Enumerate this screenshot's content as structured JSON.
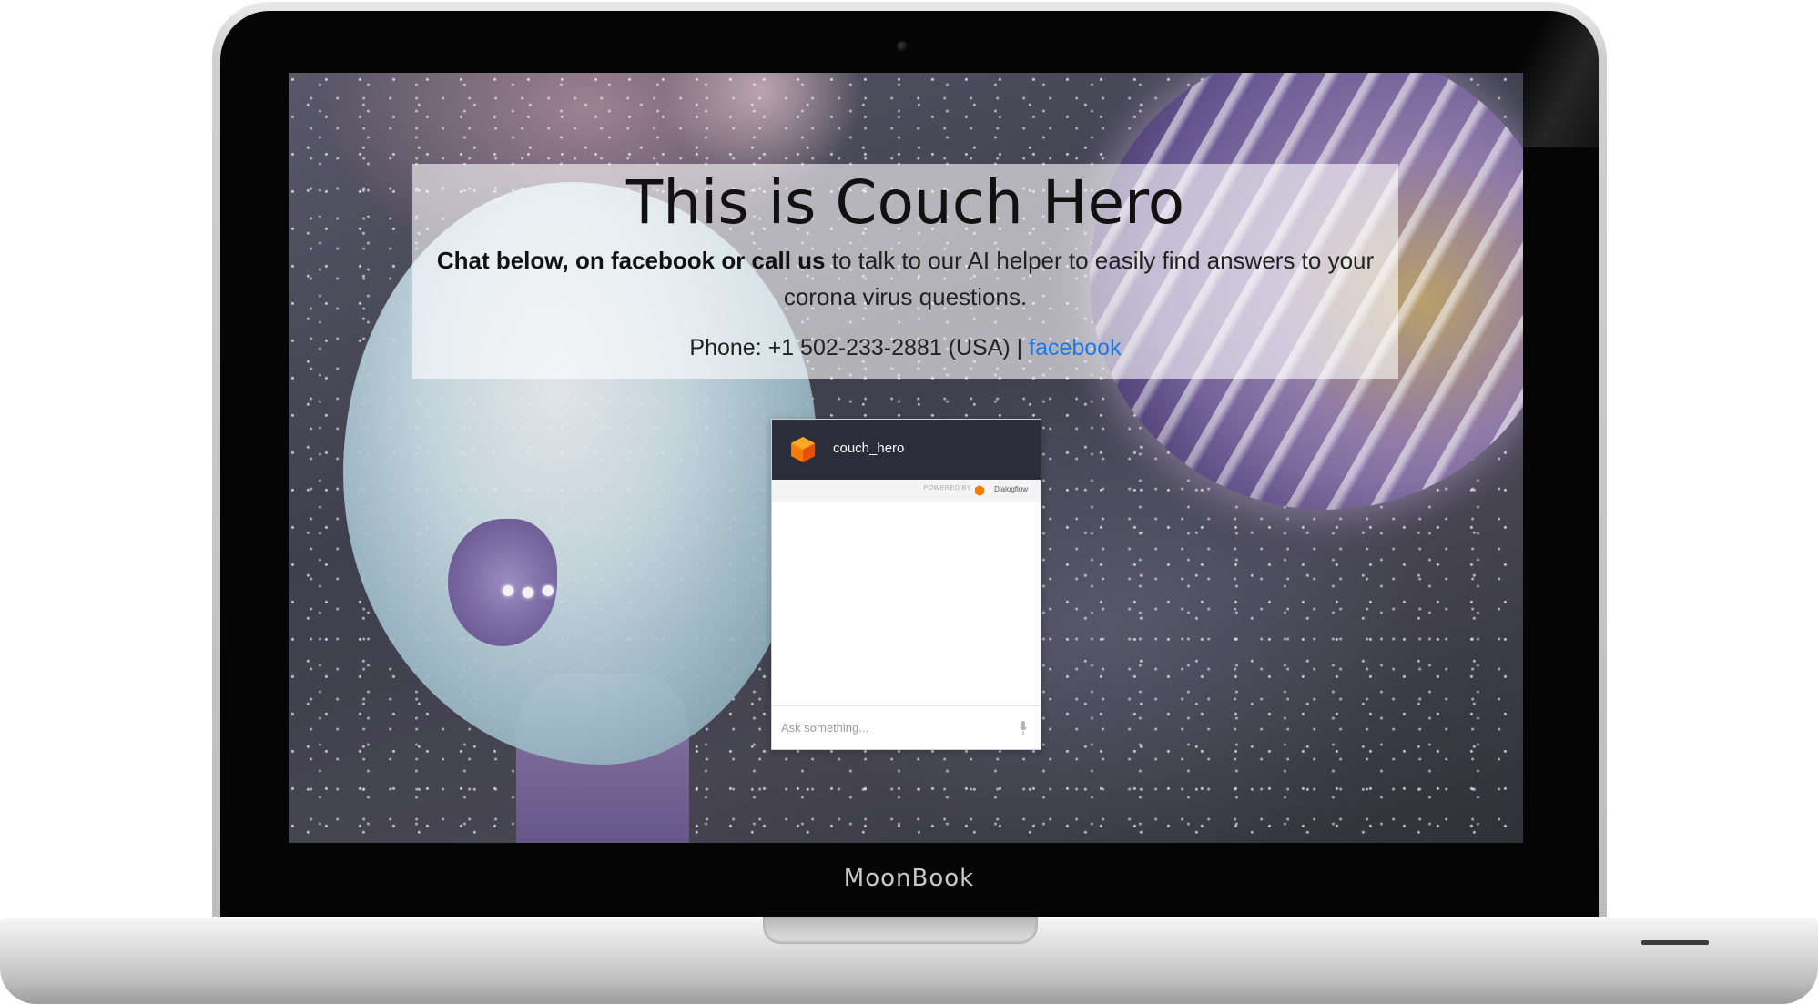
{
  "device": {
    "brand_label": "MoonBook"
  },
  "page": {
    "title": "This is Couch Hero",
    "subtitle_bold": "Chat below, on facebook or call us",
    "subtitle_rest": " to talk to our AI helper to easily find answers to your corona virus questions.",
    "phone_prefix": "Phone: +1 502-233-2881 (USA) | ",
    "facebook_link": "facebook",
    "link_color": "#1d79e6"
  },
  "chat": {
    "agent_name": "couch_hero",
    "powered_by_label": "POWERED BY",
    "provider_name": "Dialogflow",
    "input_placeholder": "Ask something...",
    "header_color": "#2b2e3a",
    "accent_color": "#f57c00",
    "icons": [
      "dialogflow-logo-icon",
      "microphone-icon"
    ]
  }
}
